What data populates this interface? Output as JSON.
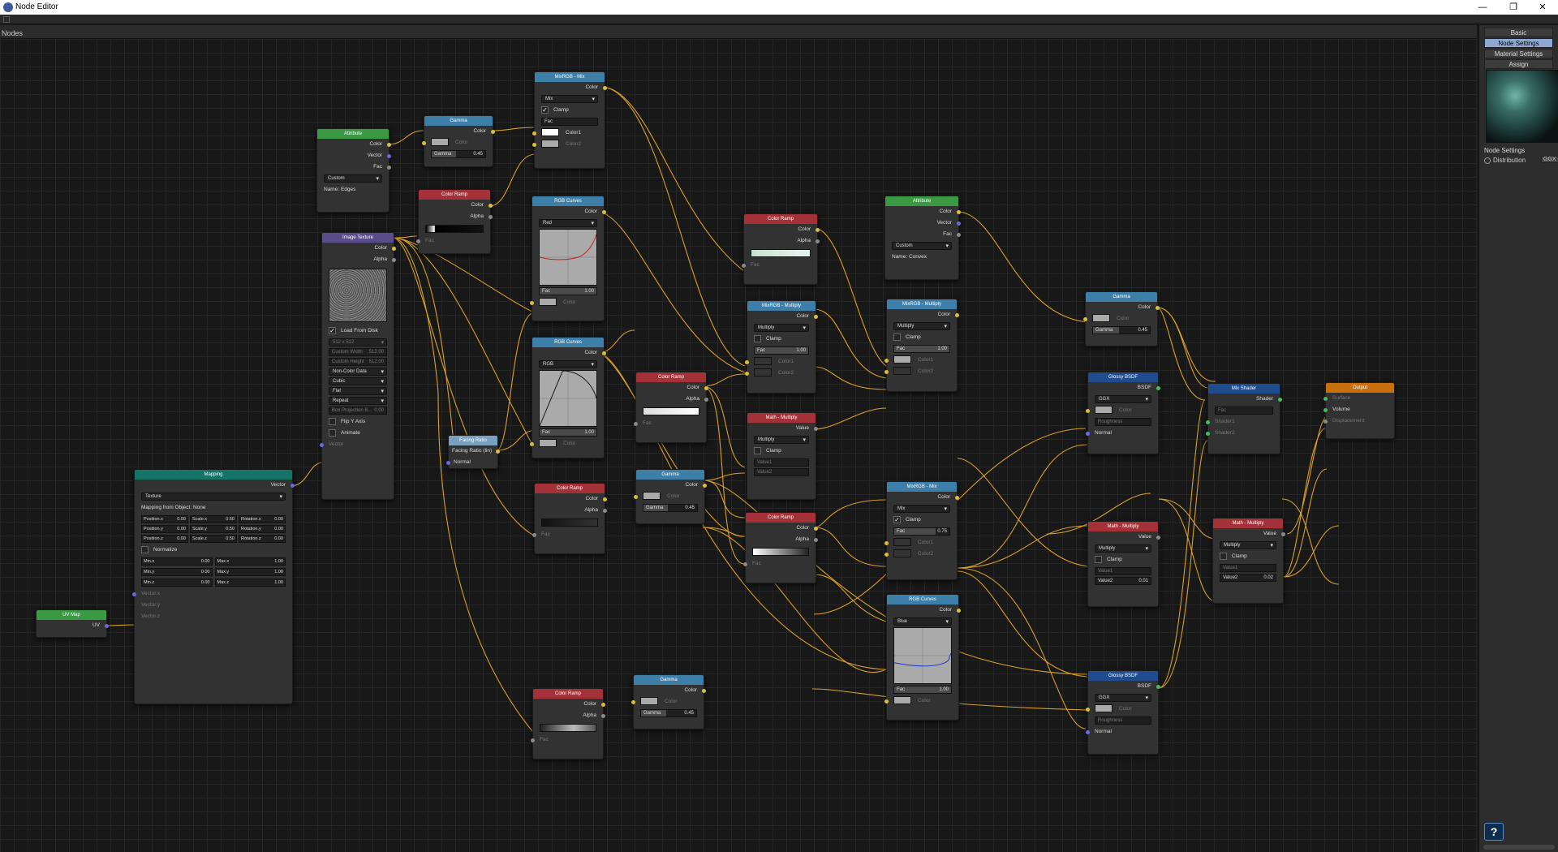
{
  "window": {
    "title": "Node Editor",
    "minimize": "—",
    "restore": "❐",
    "close": "✕"
  },
  "header": {
    "label": "Nodes"
  },
  "sidebar": {
    "tabs": [
      "Basic",
      "Node Settings",
      "Material Settings",
      "Assign"
    ],
    "active_tab": "Node Settings",
    "section_label": "Node Settings",
    "distribution_label": "Distribution",
    "distribution_value": "GGX"
  },
  "colors": {
    "wire": "#d9a02a",
    "canvas": "#181818",
    "header_green": "#3a9a44",
    "header_blue": "#3d7fa8",
    "header_red": "#a53138",
    "header_purple": "#5a4c8a",
    "header_teal": "#157468",
    "header_dark_blue": "#1e4c8c",
    "header_orange": "#c8700e"
  },
  "icons": {
    "app": "node-editor-icon",
    "help": "help-icon"
  },
  "nodes": {
    "uvmap": {
      "title": "UV Map",
      "uv": "UV"
    },
    "mapping": {
      "title": "Mapping",
      "vector_out": "Vector",
      "type": "Texture",
      "from_object": "Mapping from Object: None",
      "rows": [
        [
          "Position.x",
          "0.00",
          "Scale.x",
          "0.50",
          "Rotation.x",
          "0.00"
        ],
        [
          "Position.y",
          "0.00",
          "Scale.y",
          "0.50",
          "Rotation.y",
          "0.00"
        ],
        [
          "Position.z",
          "0.00",
          "Scale.z",
          "0.50",
          "Rotation.z",
          "0.00"
        ]
      ],
      "normalize": "Normalize",
      "minmax": [
        [
          "Min.x",
          "0.00",
          "Max.x",
          "1.00"
        ],
        [
          "Min.y",
          "0.00",
          "Max.y",
          "1.00"
        ],
        [
          "Min.z",
          "0.00",
          "Max.z",
          "1.00"
        ]
      ],
      "vec_in": [
        "Vector.x",
        "Vector.y",
        "Vector.z"
      ]
    },
    "attr1": {
      "title": "Attribute",
      "color": "Color",
      "vector": "Vector",
      "fac": "Fac",
      "mode": "Custom",
      "name": "Name: Edges"
    },
    "gamma1": {
      "title": "Gamma",
      "color_out": "Color",
      "color_in": "Color",
      "gamma_label": "Gamma",
      "gamma_val": "0.45"
    },
    "mix1": {
      "title": "MixRGB - Mix",
      "color_out": "Color",
      "mode": "Mix",
      "clamp": "Clamp",
      "fac": "Fac",
      "color1": "Color1",
      "color2": "Color2"
    },
    "ramp1": {
      "title": "Color Ramp",
      "color": "Color",
      "alpha": "Alpha",
      "fac": "Fac"
    },
    "imgtex": {
      "title": "Image Texture",
      "color": "Color",
      "alpha": "Alpha",
      "load": "Load From Disk",
      "size": "512 x 512",
      "cw_label": "Custom Width",
      "cw": "512.00",
      "ch_label": "Custom Height",
      "ch": "512.00",
      "colorspace": "Non-Color Data",
      "interp": "Cubic",
      "proj": "Flat",
      "ext": "Repeat",
      "blend_label": "Box Projection B...",
      "blend": "0.00",
      "flip": "Flip Y Axis",
      "animate": "Animate",
      "vector": "Vector"
    },
    "curves1": {
      "title": "RGB Curves",
      "color_out": "Color",
      "channel": "Red",
      "fac": "Fac",
      "fac_val": "1.00",
      "color_in": "Color"
    },
    "curves2": {
      "title": "RGB Curves",
      "color_out": "Color",
      "channel": "RGB",
      "fac": "Fac",
      "fac_val": "1.00",
      "color_in": "Color"
    },
    "facing": {
      "title": "Facing Ratio",
      "out": "Facing Ratio (lin)",
      "normal": "Normal"
    },
    "ramp2": {
      "title": "Color Ramp",
      "color": "Color",
      "alpha": "Alpha",
      "fac": "Fac"
    },
    "ramp3": {
      "title": "Color Ramp",
      "color": "Color",
      "alpha": "Alpha",
      "fac": "Fac"
    },
    "gamma2": {
      "title": "Gamma",
      "color_out": "Color",
      "color_in": "Color",
      "gamma_label": "Gamma",
      "gamma_val": "0.45"
    },
    "ramp4": {
      "title": "Color Ramp",
      "color": "Color",
      "alpha": "Alpha",
      "fac": "Fac"
    },
    "gamma3": {
      "title": "Gamma",
      "color_out": "Color",
      "color_in": "Color",
      "gamma_label": "Gamma",
      "gamma_val": "0.45"
    },
    "ramp5": {
      "title": "Color Ramp",
      "color": "Color",
      "alpha": "Alpha",
      "fac": "Fac"
    },
    "mixmul1": {
      "title": "MixRGB - Multiply",
      "color_out": "Color",
      "mode": "Multiply",
      "clamp": "Clamp",
      "fac": "Fac",
      "fac_val": "1.00",
      "color1": "Color1",
      "color2": "Color2"
    },
    "mathmul1": {
      "title": "Math - Multiply",
      "value_out": "Value",
      "mode": "Multiply",
      "clamp": "Clamp",
      "v1": "Value1",
      "v2": "Value2"
    },
    "ramp6": {
      "title": "Color Ramp",
      "color": "Color",
      "alpha": "Alpha",
      "fac": "Fac"
    },
    "attr2": {
      "title": "Attribute",
      "color": "Color",
      "vector": "Vector",
      "fac": "Fac",
      "mode": "Custom",
      "name": "Name: Convex"
    },
    "mixmul2": {
      "title": "MixRGB - Multiply",
      "color_out": "Color",
      "mode": "Multiply",
      "clamp": "Clamp",
      "fac": "Fac",
      "fac_val": "1.00",
      "color1": "Color1",
      "color2": "Color2"
    },
    "mix2": {
      "title": "MixRGB - Mix",
      "color_out": "Color",
      "mode": "Mix",
      "clamp": "Clamp",
      "fac": "Fac",
      "fac_val": "0.75",
      "color1": "Color1",
      "color2": "Color2"
    },
    "curves3": {
      "title": "RGB Curves",
      "color_out": "Color",
      "channel": "Blue",
      "fac": "Fac",
      "fac_val": "1.00",
      "color_in": "Color"
    },
    "gamma4": {
      "title": "Gamma",
      "color_out": "Color",
      "color_in": "Color",
      "gamma_label": "Gamma",
      "gamma_val": "0.45"
    },
    "glossy1": {
      "title": "Glossy BSDF",
      "bsdf": "BSDF",
      "dist": "GGX",
      "color": "Color",
      "rough": "Roughness",
      "normal": "Normal"
    },
    "mathmul2": {
      "title": "Math - Multiply",
      "value_out": "Value",
      "mode": "Multiply",
      "clamp": "Clamp",
      "v1": "Value1",
      "v2": "Value2",
      "v2_val": "0.01"
    },
    "glossy2": {
      "title": "Glossy BSDF",
      "bsdf": "BSDF",
      "dist": "GGX",
      "color": "Color",
      "rough": "Roughness",
      "normal": "Normal"
    },
    "mixshader": {
      "title": "Mix Shader",
      "shader_out": "Shader",
      "fac": "Fac",
      "s1": "Shader1",
      "s2": "Shader2"
    },
    "mathmul3": {
      "title": "Math - Multiply",
      "value_out": "Value",
      "mode": "Multiply",
      "clamp": "Clamp",
      "v1": "Value1",
      "v2": "Value2",
      "v2_val": "0.02"
    },
    "output": {
      "title": "Output",
      "surface": "Surface",
      "volume": "Volume",
      "disp": "Displacement"
    }
  }
}
